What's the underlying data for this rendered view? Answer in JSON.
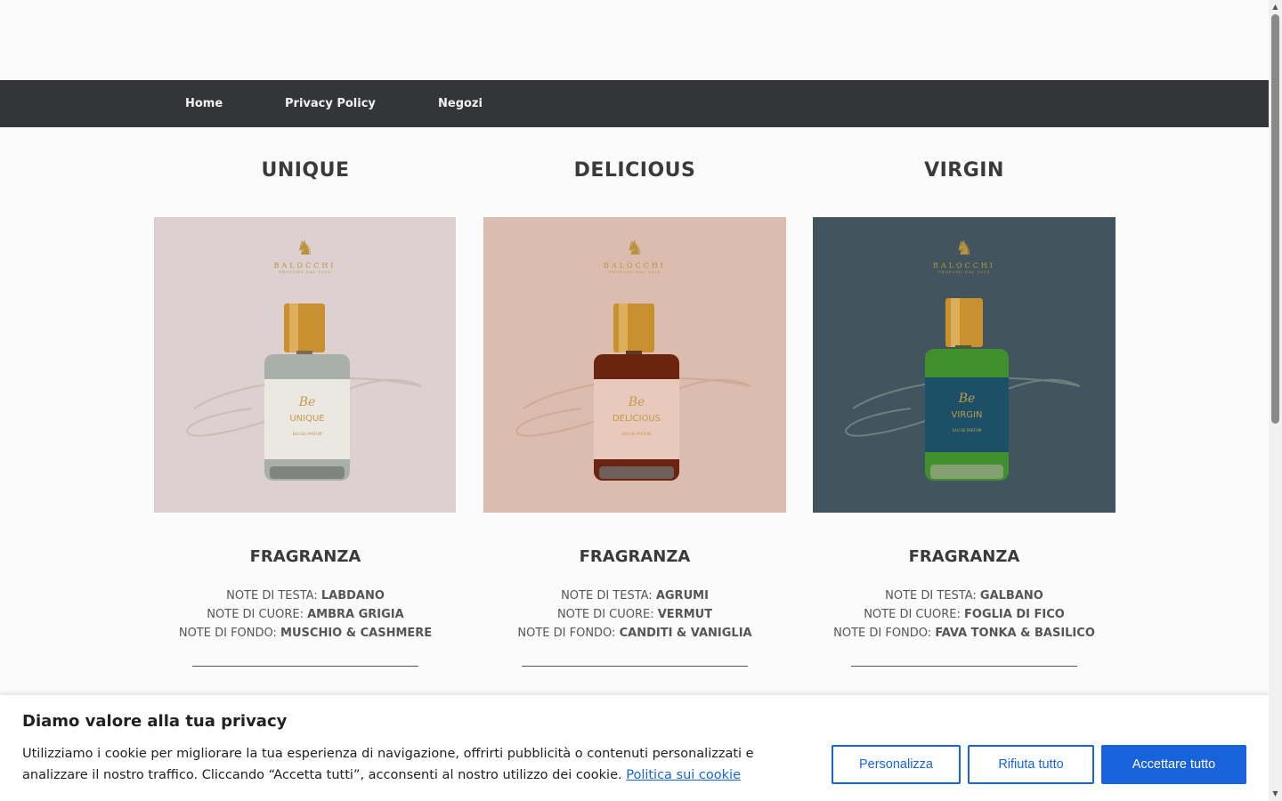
{
  "nav": {
    "items": [
      {
        "label": "Home"
      },
      {
        "label": "Privacy Policy"
      },
      {
        "label": "Negozi"
      }
    ]
  },
  "products": [
    {
      "title": "UNIQUE",
      "image": {
        "brand": "BALOCCHI",
        "tagline": "PROFUMI DAL 1926",
        "bottle_script": "Be",
        "bottle_name": "UNIQUE",
        "bottle_type": "EAU DE PARFUM",
        "background": "#dcd0d0",
        "label_color": "#ebe8e2",
        "liquid_color": "#a9b0aa"
      },
      "subtitle": "FRAGRANZA",
      "notes": [
        {
          "label": "NOTE DI TESTA:",
          "value": "LABDANO"
        },
        {
          "label": "NOTE DI CUORE:",
          "value": "AMBRA GRIGIA"
        },
        {
          "label": "NOTE DI FONDO:",
          "value": "MUSCHIO & CASHMERE"
        }
      ]
    },
    {
      "title": "DELICIOUS",
      "image": {
        "brand": "BALOCCHI",
        "tagline": "PROFUMI DAL 1926",
        "bottle_script": "Be",
        "bottle_name": "DELICIOUS",
        "bottle_type": "EAU DE PARFUM",
        "background": "#dcbcaf",
        "label_color": "#e9c9bc",
        "liquid_color": "#6a2410"
      },
      "subtitle": "FRAGRANZA",
      "notes": [
        {
          "label": "NOTE DI TESTA:",
          "value": "AGRUMI"
        },
        {
          "label": "NOTE DI CUORE:",
          "value": "VERMUT"
        },
        {
          "label": "NOTE DI FONDO:",
          "value": "CANDITI & VANIGLIA"
        }
      ]
    },
    {
      "title": "VIRGIN",
      "image": {
        "brand": "BALOCCHI",
        "tagline": "PROFUMI DAL 1926",
        "bottle_script": "Be",
        "bottle_name": "VIRGIN",
        "bottle_type": "EAU DE PARFUM",
        "background": "#42555e",
        "label_color": "#1d4f66",
        "liquid_color": "#3f8f2e"
      },
      "subtitle": "FRAGRANZA",
      "notes": [
        {
          "label": "NOTE DI TESTA:",
          "value": "GALBANO"
        },
        {
          "label": "NOTE DI CUORE:",
          "value": "FOGLIA DI FICO"
        },
        {
          "label": "NOTE DI FONDO:",
          "value": "FAVA TONKA & BASILICO"
        }
      ]
    }
  ],
  "cookie_banner": {
    "title": "Diamo valore alla tua privacy",
    "text": "Utilizziamo i cookie per migliorare la tua esperienza di navigazione, offrirti pubblicità o contenuti personalizzati e analizzare il nostro traffico. Cliccando “Accetta tutti”, acconsenti al nostro utilizzo dei cookie.",
    "link_label": "Politica sui cookie",
    "buttons": {
      "customize": "Personalizza",
      "reject": "Rifiuta tutto",
      "accept": "Accettare tutto"
    },
    "accent_color": "#1863dc"
  },
  "colors": {
    "navbar": "#343538",
    "page_bg": "#fbfbfb"
  }
}
